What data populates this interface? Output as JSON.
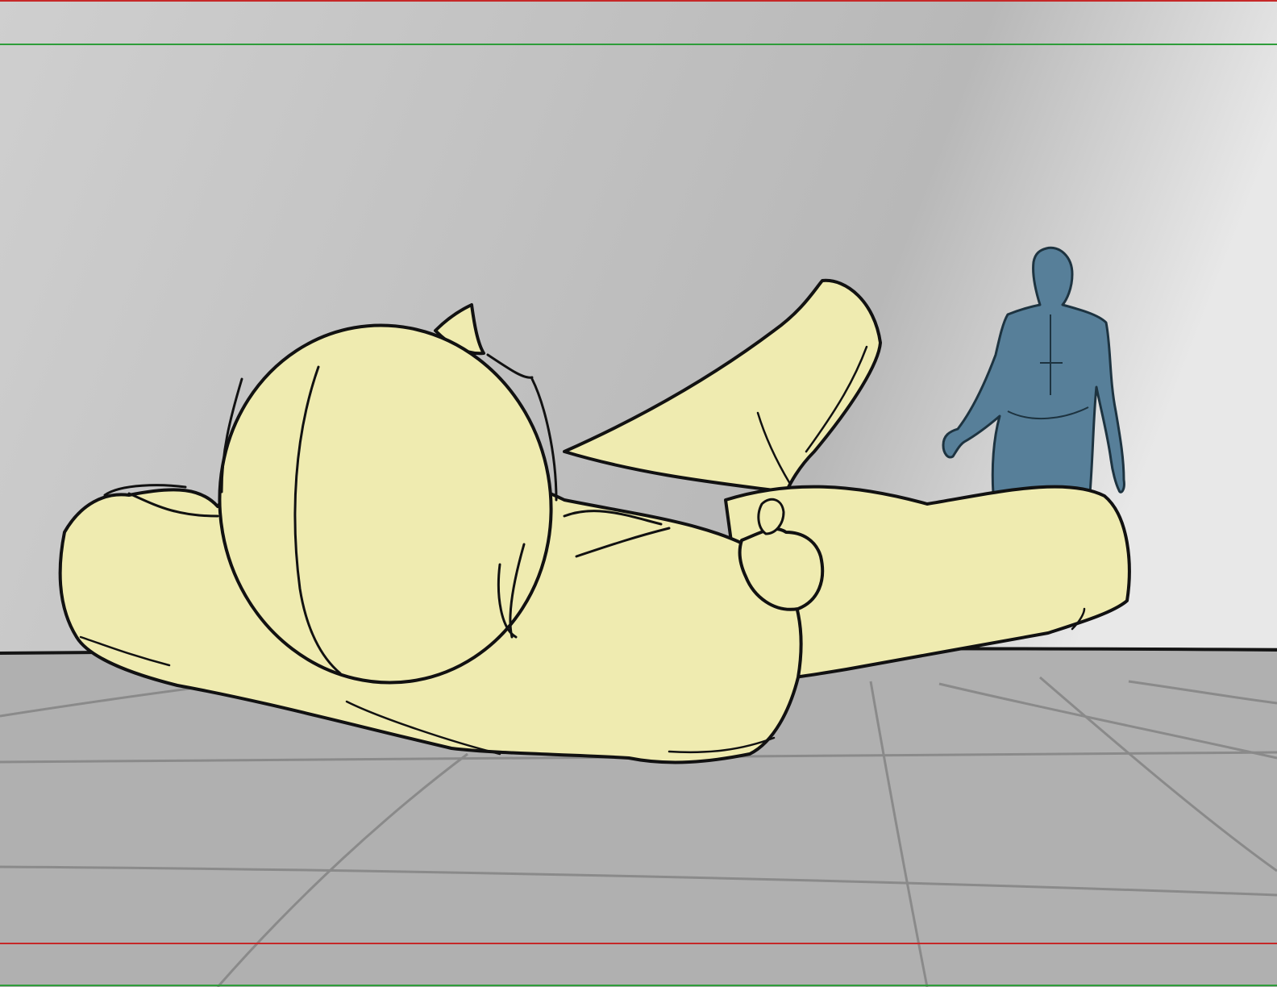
{
  "colors": {
    "wall_top": "#cfcfcf",
    "wall_bottom": "#b8b8b8",
    "wall_right_highlight": "#e8e8e8",
    "floor": "#b0b0b0",
    "floor_grid": "#8a8a8a",
    "horizon_line": "#151515",
    "ink": "#111111",
    "figure_fill": "#efebb0",
    "standing_figure_fill": "#577f99",
    "standing_figure_ink": "#1d3340",
    "safe_guide": "#c62828",
    "action_guide": "#2e9d3a"
  },
  "icons": {
    "reclining_figure": "reclining-figure-icon",
    "standing_figure": "standing-figure-icon"
  }
}
